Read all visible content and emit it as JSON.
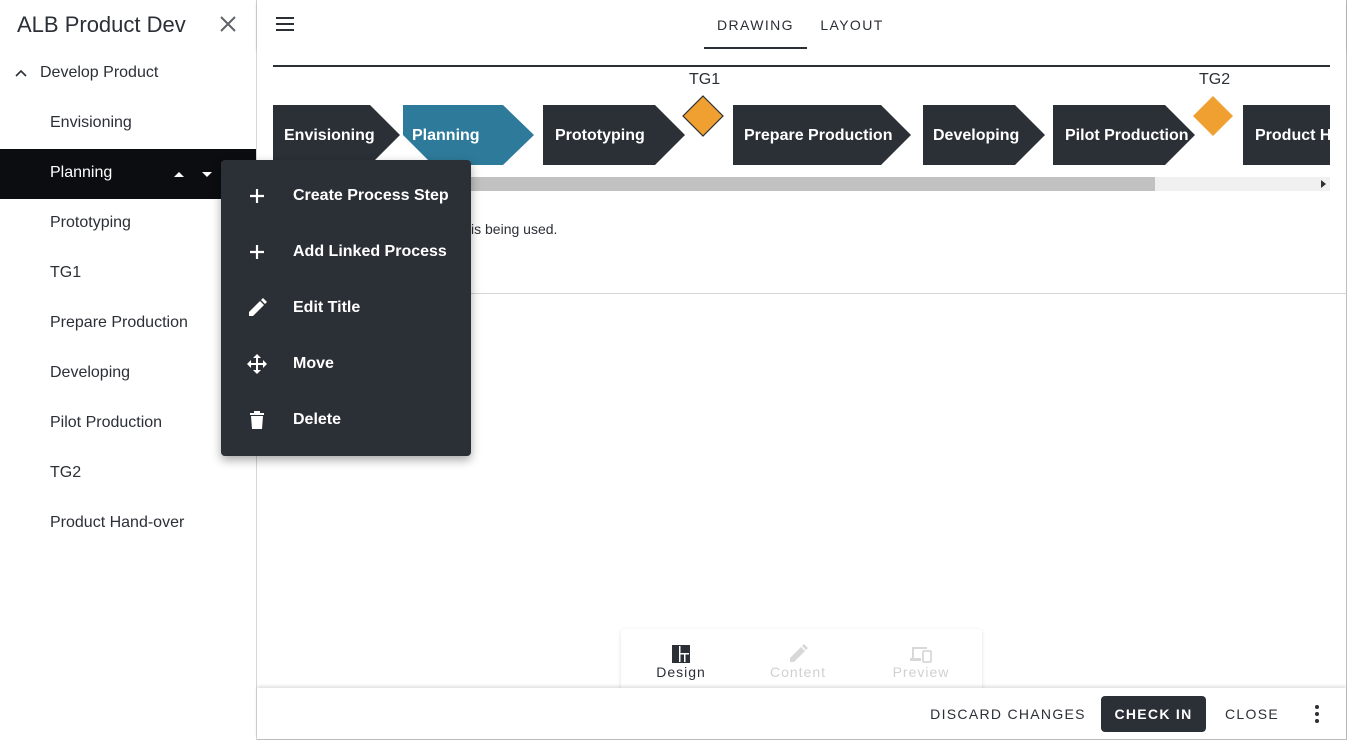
{
  "sidebar": {
    "title": "ALB Product Dev",
    "parent": "Develop Product",
    "items": [
      {
        "label": "Envisioning"
      },
      {
        "label": "Planning"
      },
      {
        "label": "Prototyping"
      },
      {
        "label": "TG1"
      },
      {
        "label": "Prepare Production"
      },
      {
        "label": "Developing"
      },
      {
        "label": "Pilot Production"
      },
      {
        "label": "TG2"
      },
      {
        "label": "Product Hand-over"
      }
    ]
  },
  "tabs": [
    {
      "label": "DRAWING",
      "active": true
    },
    {
      "label": "LAYOUT",
      "active": false
    }
  ],
  "drawing": {
    "steps": [
      "Envisioning",
      "Planning",
      "Prototyping",
      "Prepare Production",
      "Developing",
      "Pilot Production",
      "Product Hand-over"
    ],
    "gates": [
      "TG1",
      "TG2"
    ],
    "colors": {
      "step": "#2b2f36",
      "active_step": "#2e7a9a",
      "gate": "#f0a030"
    }
  },
  "info_text": "a drawing, the parent's drawing is being used.",
  "context_menu": [
    {
      "label": "Create Process Step",
      "icon": "plus-icon"
    },
    {
      "label": "Add Linked Process",
      "icon": "plus-icon"
    },
    {
      "label": "Edit Title",
      "icon": "pencil-icon"
    },
    {
      "label": "Move",
      "icon": "move-icon"
    },
    {
      "label": "Delete",
      "icon": "trash-icon"
    }
  ],
  "modes": [
    {
      "label": "Design",
      "icon": "design-icon",
      "enabled": true
    },
    {
      "label": "Content",
      "icon": "pencil-icon",
      "enabled": false
    },
    {
      "label": "Preview",
      "icon": "devices-icon",
      "enabled": false
    }
  ],
  "footer": {
    "discard": "DISCARD CHANGES",
    "check_in": "CHECK IN",
    "close": "CLOSE"
  }
}
